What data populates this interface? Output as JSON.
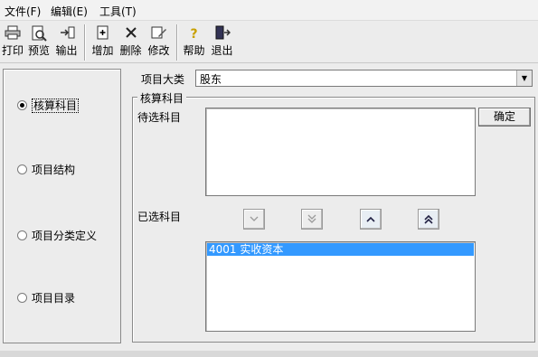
{
  "menu": [
    "文件(F)",
    "编辑(E)",
    "工具(T)"
  ],
  "toolbar": {
    "print": "打印",
    "preview": "预览",
    "export": "输出",
    "add": "增加",
    "delete": "删除",
    "modify": "修改",
    "help": "帮助",
    "exit": "退出"
  },
  "sidebar": {
    "selected": 0,
    "items": [
      "核算科目",
      "项目结构",
      "项目分类定义",
      "项目目录"
    ]
  },
  "main": {
    "category_label": "项目大类",
    "category_value": "股东",
    "group_title": "核算科目",
    "pending_label": "待选科目",
    "selected_label": "已选科目",
    "confirm": "确定",
    "pending_items": [],
    "selected_items": [
      "4001  实收资本"
    ]
  },
  "colors": {
    "selection": "#3399ff",
    "chrome": "#ececec"
  }
}
